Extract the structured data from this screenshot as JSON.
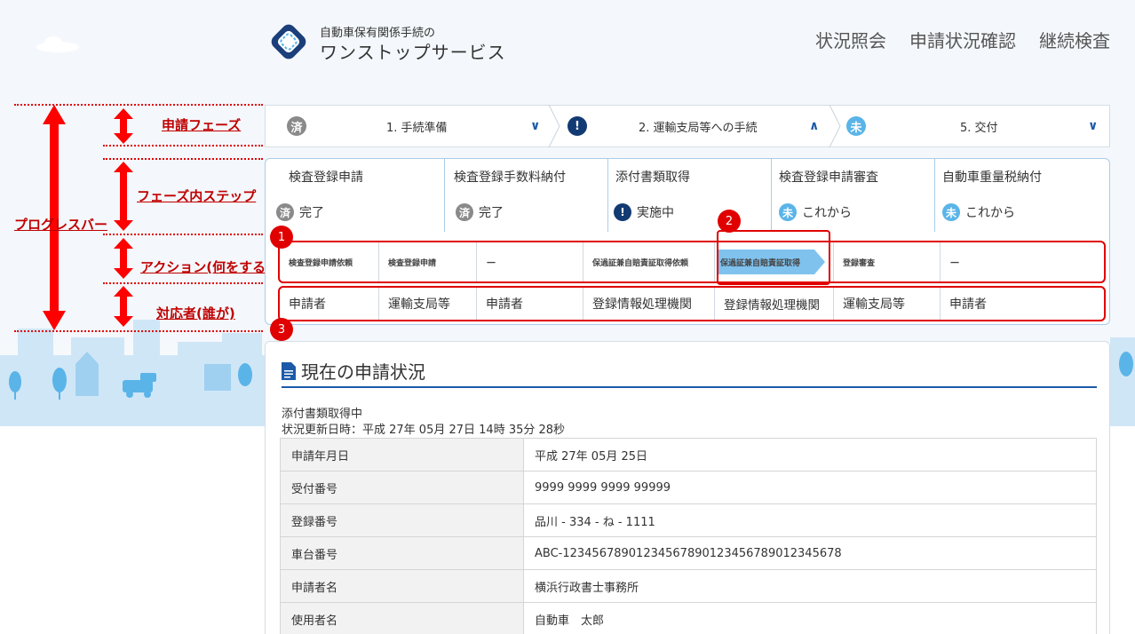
{
  "header": {
    "logo_sub": "自動車保有関係手続の",
    "logo_main": "ワンストップサービス",
    "nav": [
      "状況照会",
      "申請状況確認",
      "継続検査"
    ]
  },
  "annotations": {
    "progress_bar": "プログレスバー",
    "phase": "申請フェーズ",
    "phase_step": "フェーズ内ステップ",
    "action": "アクション(何をする)",
    "actor": "対応者(誰が)",
    "numbers": [
      "1",
      "2",
      "3"
    ]
  },
  "phases": [
    {
      "badge": "済",
      "label": "1. 手続準備",
      "state": "done"
    },
    {
      "badge": "!",
      "label": "2. 運輸支局等への手続",
      "state": "active"
    },
    {
      "badge": "未",
      "label": "5. 交付",
      "state": "todo"
    }
  ],
  "steps": [
    {
      "title": "検査登録申請",
      "badge": "済",
      "status": "完了",
      "state": "done"
    },
    {
      "title": "検査登録手数料納付",
      "badge": "済",
      "status": "完了",
      "state": "done"
    },
    {
      "title": "添付書類取得",
      "badge": "!",
      "status": "実施中",
      "state": "active"
    },
    {
      "title": "検査登録申請審査",
      "badge": "未",
      "status": "これから",
      "state": "todo"
    },
    {
      "title": "自動車重量税納付",
      "badge": "未",
      "status": "これから",
      "state": "todo"
    }
  ],
  "actions": [
    "検査登録申請依頼",
    "検査登録申請",
    "－",
    "保過証兼自賠責証取得依頼",
    "保過証兼自賠責証取得",
    "登録審査",
    "－"
  ],
  "actors": [
    "申請者",
    "運輸支局等",
    "申請者",
    "登録情報処理機関",
    "登録情報処理機関",
    "運輸支局等",
    "申請者"
  ],
  "status": {
    "title": "現在の申請状況",
    "state_text": "添付書類取得中",
    "updated": "状況更新日時：平成 27年 05月 27日 14時 35分 28秒",
    "rows": [
      {
        "key": "申請年月日",
        "value": "平成 27年 05月 25日"
      },
      {
        "key": "受付番号",
        "value": "9999 9999 9999 99999"
      },
      {
        "key": "登録番号",
        "value": "品川 - 334 - ね - 1111"
      },
      {
        "key": "車台番号",
        "value": "ABC-1234567890123456789012345678901234567­8"
      },
      {
        "key": "申請者名",
        "value": "横浜行政書士事務所"
      },
      {
        "key": "使用者名",
        "value": "自動車　太郎"
      }
    ]
  },
  "colors": {
    "accent": "#1b5aa8",
    "done": "#8a8a8a",
    "todo": "#5ab4e8",
    "annotation": "#e00000"
  }
}
